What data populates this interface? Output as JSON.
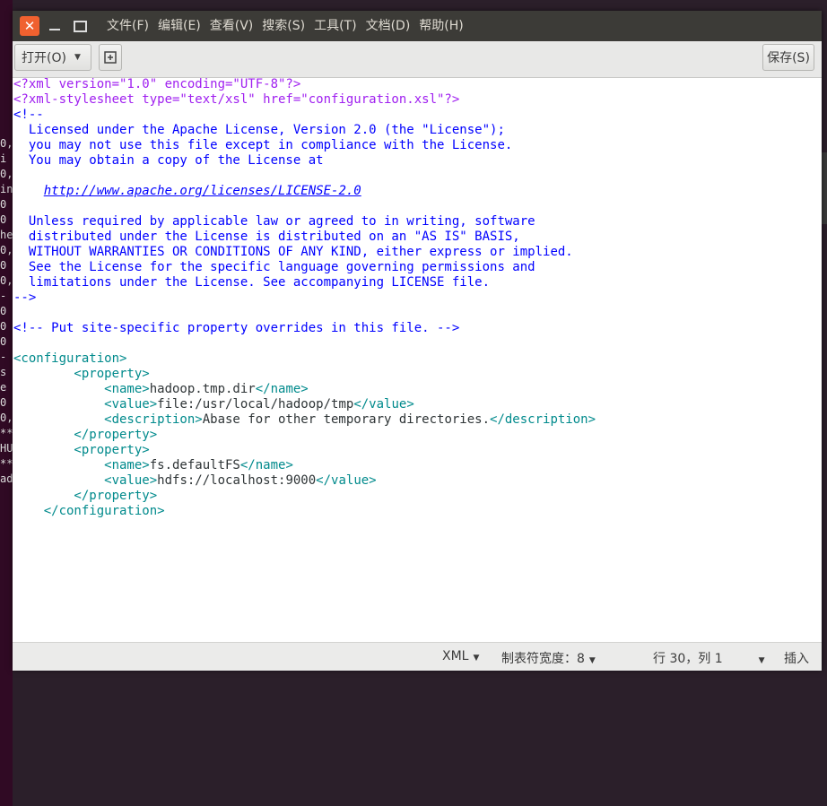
{
  "window": {
    "menu": [
      "文件(F)",
      "编辑(E)",
      "查看(V)",
      "搜索(S)",
      "工具(T)",
      "文档(D)",
      "帮助(H)"
    ]
  },
  "toolbar": {
    "open_label": "打开(O)",
    "save_label": "保存(S)"
  },
  "editor": {
    "lines": [
      [
        {
          "t": "<?xml version=\"1.0\" encoding=\"UTF-8\"?>",
          "c": "pi"
        }
      ],
      [
        {
          "t": "<?xml-stylesheet type=\"text/xsl\" href=\"configuration.xsl\"?>",
          "c": "pi"
        }
      ],
      [
        {
          "t": "<!--",
          "c": "cm"
        }
      ],
      [
        {
          "t": "  Licensed under the Apache License, Version 2.0 (the \"License\");",
          "c": "cm"
        }
      ],
      [
        {
          "t": "  you may not use this file except in compliance with the License.",
          "c": "cm"
        }
      ],
      [
        {
          "t": "  You may obtain a copy of the License at",
          "c": "cm"
        }
      ],
      [],
      [
        {
          "t": "    ",
          "c": "cm"
        },
        {
          "t": "http://www.apache.org/licenses/LICENSE-2.0",
          "c": "lk"
        }
      ],
      [],
      [
        {
          "t": "  Unless required by applicable law or agreed to in writing, software",
          "c": "cm"
        }
      ],
      [
        {
          "t": "  distributed under the License is distributed on an \"AS IS\" BASIS,",
          "c": "cm"
        }
      ],
      [
        {
          "t": "  WITHOUT WARRANTIES OR CONDITIONS OF ANY KIND, either express or implied.",
          "c": "cm"
        }
      ],
      [
        {
          "t": "  See the License for the specific language governing permissions and",
          "c": "cm"
        }
      ],
      [
        {
          "t": "  limitations under the License. See accompanying LICENSE file.",
          "c": "cm"
        }
      ],
      [
        {
          "t": "-->",
          "c": "cm"
        }
      ],
      [],
      [
        {
          "t": "<!-- Put site-specific property overrides in this file. -->",
          "c": "cm"
        }
      ],
      [],
      [
        {
          "t": "<configuration>",
          "c": "tg"
        }
      ],
      [
        {
          "t": "        <property>",
          "c": "tg"
        }
      ],
      [
        {
          "t": "            <name>",
          "c": "tg"
        },
        {
          "t": "hadoop.tmp.dir",
          "c": "tx"
        },
        {
          "t": "</name>",
          "c": "tg"
        }
      ],
      [
        {
          "t": "            <value>",
          "c": "tg"
        },
        {
          "t": "file:/usr/local/hadoop/tmp",
          "c": "tx"
        },
        {
          "t": "</value>",
          "c": "tg"
        }
      ],
      [
        {
          "t": "            <description>",
          "c": "tg"
        },
        {
          "t": "Abase for other temporary directories.",
          "c": "tx"
        },
        {
          "t": "</description>",
          "c": "tg"
        }
      ],
      [
        {
          "t": "        </property>",
          "c": "tg"
        }
      ],
      [
        {
          "t": "        <property>",
          "c": "tg"
        }
      ],
      [
        {
          "t": "            <name>",
          "c": "tg"
        },
        {
          "t": "fs.defaultFS",
          "c": "tx"
        },
        {
          "t": "</name>",
          "c": "tg"
        }
      ],
      [
        {
          "t": "            <value>",
          "c": "tg"
        },
        {
          "t": "hdfs://localhost:9000",
          "c": "tx"
        },
        {
          "t": "</value>",
          "c": "tg"
        }
      ],
      [
        {
          "t": "        </property>",
          "c": "tg"
        }
      ],
      [
        {
          "t": "    </configuration>",
          "c": "tg"
        }
      ]
    ]
  },
  "statusbar": {
    "language": "XML",
    "tab_width": "制表符宽度：8",
    "position": "行 30，列 1",
    "mode": "插入"
  },
  "background": {
    "terminal_chars": [
      "0,",
      "i",
      "0,",
      "in",
      "0",
      "0",
      "he",
      "0,",
      "0",
      "0,",
      "-",
      "0",
      "0",
      "0",
      "-",
      "s",
      "e",
      "0",
      "0,",
      "**",
      "HU",
      "**",
      "ad"
    ]
  },
  "colors": {
    "titlebar": "#3c3b37",
    "close_button": "#f0612f",
    "processing_instruction": "#a020f0",
    "comment": "#0000ff",
    "tag": "#008a8c"
  }
}
